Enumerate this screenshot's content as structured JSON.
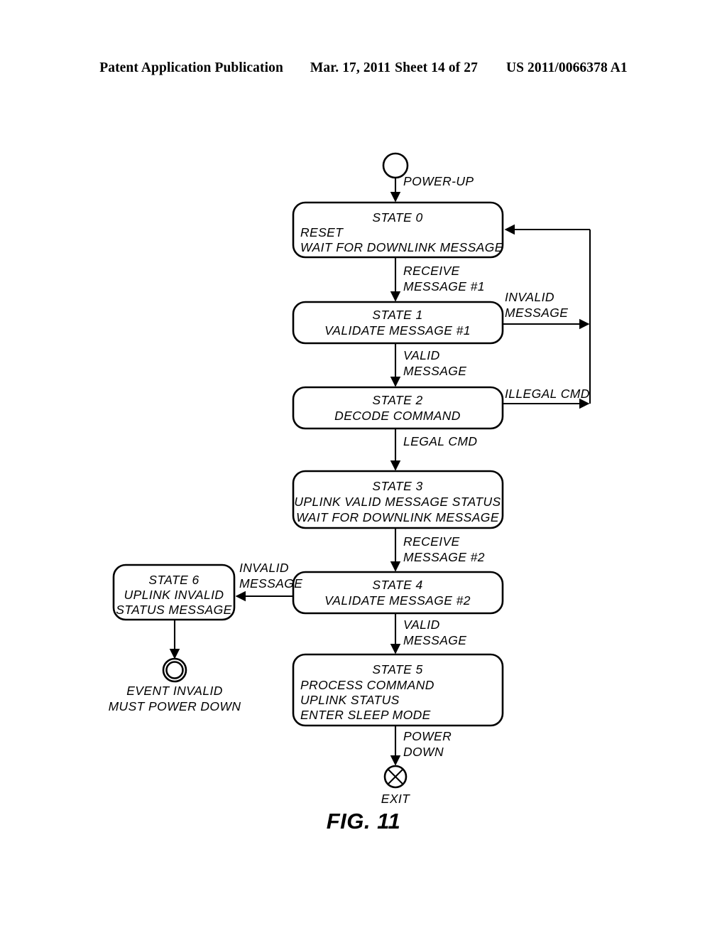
{
  "header": {
    "publication": "Patent Application Publication",
    "date": "Mar. 17, 2011",
    "sheet": "Sheet 14 of 27",
    "number": "US 2011/0066378 A1"
  },
  "figure": {
    "caption": "FIG. 11",
    "type": "state-machine-diagram",
    "start_node": {
      "name": "start-circle",
      "label": "POWER-UP"
    },
    "states": [
      {
        "id": "state0",
        "title": "STATE 0",
        "lines": [
          "RESET",
          "WAIT FOR DOWNLINK MESSAGE"
        ],
        "align": "left"
      },
      {
        "id": "state1",
        "title": "STATE 1",
        "lines": [
          "VALIDATE MESSAGE #1"
        ],
        "align": "center"
      },
      {
        "id": "state2",
        "title": "STATE 2",
        "lines": [
          "DECODE COMMAND"
        ],
        "align": "center"
      },
      {
        "id": "state3",
        "title": "STATE 3",
        "lines": [
          "UPLINK VALID MESSAGE STATUS",
          "WAIT FOR DOWNLINK MESSAGE"
        ],
        "align": "center"
      },
      {
        "id": "state4",
        "title": "STATE 4",
        "lines": [
          "VALIDATE MESSAGE #2"
        ],
        "align": "center"
      },
      {
        "id": "state5",
        "title": "STATE 5",
        "lines": [
          "PROCESS COMMAND",
          "UPLINK STATUS",
          "ENTER SLEEP MODE"
        ],
        "align": "left"
      },
      {
        "id": "state6",
        "title": "STATE 6",
        "lines": [
          "UPLINK INVALID",
          "STATUS MESSAGE"
        ],
        "align": "center"
      }
    ],
    "transitions": [
      {
        "id": "t-powerup",
        "from": "start",
        "to": "state0",
        "lines": [
          "POWER-UP"
        ]
      },
      {
        "id": "t-recv1",
        "from": "state0",
        "to": "state1",
        "lines": [
          "RECEIVE",
          "MESSAGE #1"
        ]
      },
      {
        "id": "t-invalid1",
        "from": "state1",
        "to": "state0",
        "lines": [
          "INVALID",
          "MESSAGE"
        ]
      },
      {
        "id": "t-valid1",
        "from": "state1",
        "to": "state2",
        "lines": [
          "VALID",
          "MESSAGE"
        ]
      },
      {
        "id": "t-illegal",
        "from": "state2",
        "to": "state0",
        "lines": [
          "ILLEGAL CMD"
        ]
      },
      {
        "id": "t-legal",
        "from": "state2",
        "to": "state3",
        "lines": [
          "LEGAL CMD"
        ]
      },
      {
        "id": "t-recv2",
        "from": "state3",
        "to": "state4",
        "lines": [
          "RECEIVE",
          "MESSAGE #2"
        ]
      },
      {
        "id": "t-invalid2",
        "from": "state4",
        "to": "state6",
        "lines": [
          "INVALID",
          "MESSAGE"
        ]
      },
      {
        "id": "t-valid2",
        "from": "state4",
        "to": "state5",
        "lines": [
          "VALID",
          "MESSAGE"
        ]
      },
      {
        "id": "t-powerdown",
        "from": "state5",
        "to": "exit",
        "lines": [
          "POWER",
          "DOWN"
        ]
      },
      {
        "id": "t-to-final",
        "from": "state6",
        "to": "final",
        "lines": []
      }
    ],
    "end_nodes": [
      {
        "id": "final",
        "name": "final-state-circle",
        "lines": [
          "EVENT INVALID",
          "MUST POWER DOWN"
        ]
      },
      {
        "id": "exit",
        "name": "exit-circle",
        "lines": [
          "EXIT"
        ]
      }
    ]
  }
}
